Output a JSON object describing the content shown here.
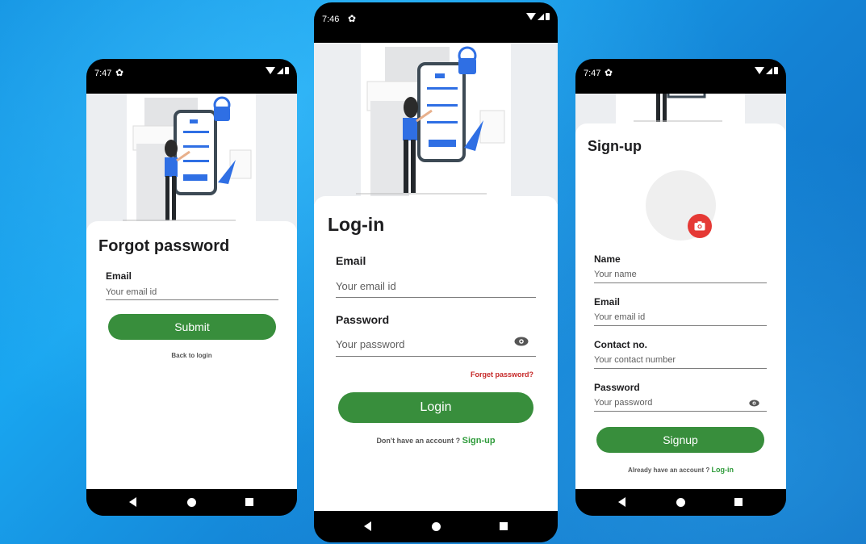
{
  "forgot": {
    "status_time": "7:47",
    "title": "Forgot password",
    "email_label": "Email",
    "email_placeholder": "Your email id",
    "submit_label": "Submit",
    "back_link": "Back to login"
  },
  "login": {
    "status_time": "7:46",
    "title": "Log-in",
    "email_label": "Email",
    "email_placeholder": "Your email id",
    "password_label": "Password",
    "password_placeholder": "Your password",
    "forgot_link": "Forget password?",
    "login_label": "Login",
    "no_account_text": "Don't have an account ?",
    "signup_link": "Sign-up"
  },
  "signup": {
    "status_time": "7:47",
    "title": "Sign-up",
    "name_label": "Name",
    "name_placeholder": "Your name",
    "email_label": "Email",
    "email_placeholder": "Your email id",
    "contact_label": "Contact no.",
    "contact_placeholder": "Your contact number",
    "password_label": "Password",
    "password_placeholder": "Your password",
    "signup_label": "Signup",
    "have_account_text": "Already have an account ?",
    "login_link": "Log-in"
  },
  "icons": {
    "settings": "gear-icon",
    "wifi": "wifi-icon",
    "signal": "signal-icon",
    "battery": "battery-icon",
    "eye": "eye-icon",
    "camera": "camera-icon",
    "back": "nav-back-icon",
    "home": "nav-home-icon",
    "recents": "nav-recents-icon"
  },
  "colors": {
    "primary_button": "#388e3c",
    "link_green": "#2e9b3a",
    "link_red": "#c62828",
    "camera_badge": "#e53935",
    "illustration_blue": "#2f6fe4"
  }
}
